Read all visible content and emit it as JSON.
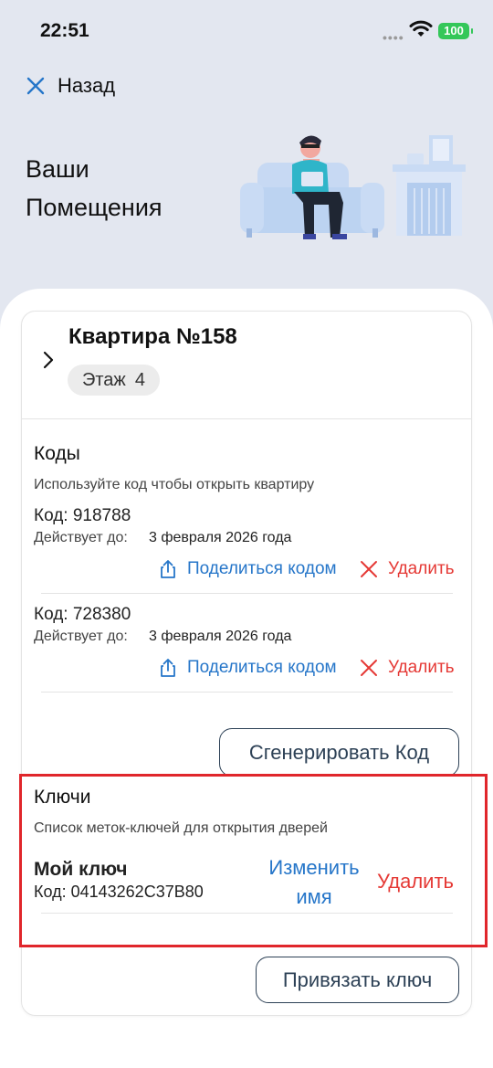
{
  "status": {
    "time": "22:51",
    "battery": "100"
  },
  "nav": {
    "back_label": "Назад"
  },
  "page": {
    "title": "Ваши Помещения"
  },
  "apartment": {
    "title": "Квартира №158",
    "floor_label": "Этаж",
    "floor_value": "4"
  },
  "codes": {
    "title": "Коды",
    "description": "Используйте код чтобы открыть квартиру",
    "items": [
      {
        "code": "Код: 918788",
        "valid_label": "Действует до:",
        "valid_value": "3 февраля 2026 года",
        "share_label": "Поделиться кодом",
        "delete_label": "Удалить"
      },
      {
        "code": "Код: 728380",
        "valid_label": "Действует до:",
        "valid_value": "3 февраля 2026 года",
        "share_label": "Поделиться кодом",
        "delete_label": "Удалить"
      }
    ],
    "generate_label": "Сгенерировать Код"
  },
  "keys": {
    "title": "Ключи",
    "description": "Список меток-ключей для открытия дверей",
    "items": [
      {
        "name": "Мой ключ",
        "code": "Код: 04143262C37B80",
        "rename_label": "Изменить имя",
        "delete_label": "Удалить"
      }
    ],
    "bind_label": "Привязать ключ"
  },
  "colors": {
    "accent": "#2676c9",
    "danger": "#e53935",
    "battery": "#34c759",
    "highlight": "#e0262b"
  }
}
